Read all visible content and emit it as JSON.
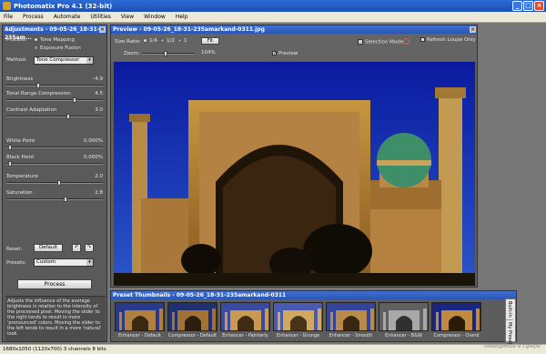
{
  "app": {
    "title": "Photomatix Pro 4.1 (32-bit)"
  },
  "menu": [
    "File",
    "Process",
    "Automate",
    "Utilities",
    "View",
    "Window",
    "Help"
  ],
  "adjustments": {
    "title": "Adjustments - 09-05-26_18-31-235am...",
    "process_label": "Process:",
    "process_options": [
      "Tone Mapping",
      "Exposure Fusion"
    ],
    "method_label": "Method:",
    "method_value": "Tone Compressor",
    "sliders": [
      {
        "label": "Brightness",
        "value": "-4.9",
        "level": 0.32
      },
      {
        "label": "Tonal Range Compression",
        "value": "4.5",
        "level": 0.72
      },
      {
        "label": "Contrast Adaptation",
        "value": "3.0",
        "level": 0.65
      },
      {
        "label": "White Point",
        "value": "0.000%",
        "level": 0.02
      },
      {
        "label": "Black Point",
        "value": "0.000%",
        "level": 0.02
      },
      {
        "label": "Temperature",
        "value": "2.0",
        "level": 0.55
      },
      {
        "label": "Saturation",
        "value": "2.8",
        "level": 0.62
      }
    ],
    "reset_label": "Reset:",
    "reset_button": "Default",
    "presets_label": "Presets:",
    "presets_value": "Custom",
    "process_button": "Process",
    "help_text": "Adjusts the influence of the average brightness in relation to the intensity of the processed pixel. Moving the slider to the right tends to result in more 'pronounced' colors. Moving the slider to the left tends to result in a more 'natural' look."
  },
  "preview": {
    "title": "Preview - 09-05-26_18-31-235amarkand-0311.jpg",
    "size_ratio_label": "Size Ratio:",
    "size_options": [
      "1/4",
      "1/2",
      "1"
    ],
    "fit_button": "Fit",
    "zoom_label": "Zoom:",
    "zoom_value": "104%",
    "selection_mode": "Selection Mode",
    "refresh_label": "Refresh Loupe Only",
    "preview_checkbox": "Preview"
  },
  "thumbnails": {
    "title": "Preset Thumbnails - 09-05-26_18-31-235amarkand-0311",
    "items": [
      "Enhancer - Default",
      "Compressor - Default",
      "Enhancer - Painterly",
      "Enhancer - Grunge",
      "Enhancer - Smooth",
      "Enhancer - B&W",
      "Compressor - Overd"
    ],
    "side_tabs": [
      "Built-In",
      "My Presets"
    ]
  },
  "status": {
    "text": "1680x1050 (1120x700) 3 channels 8 bits"
  },
  "watermark": "невидимое в сфере"
}
